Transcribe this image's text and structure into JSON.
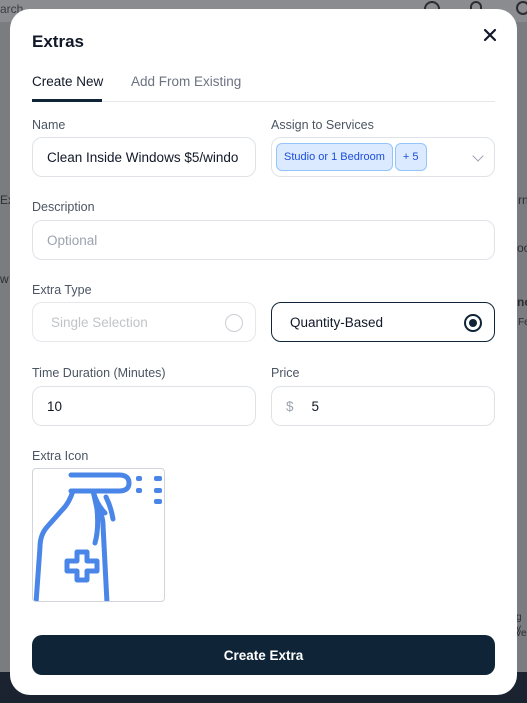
{
  "background": {
    "search_text": "arch",
    "fragments": [
      "Ex",
      "w",
      "rn",
      "oo",
      "no",
      "Fe",
      "g y",
      "ve"
    ]
  },
  "modal": {
    "title": "Extras",
    "close_icon": "close-icon",
    "tabs": [
      {
        "label": "Create New",
        "active": true
      },
      {
        "label": "Add From Existing",
        "active": false
      }
    ],
    "name": {
      "label": "Name",
      "value": "Clean Inside Windows $5/windo"
    },
    "assign": {
      "label": "Assign to Services",
      "chips": [
        "Studio or 1 Bedroom",
        "+ 5"
      ]
    },
    "description": {
      "label": "Description",
      "placeholder": "Optional"
    },
    "extra_type": {
      "label": "Extra Type",
      "options": [
        {
          "label": "Single Selection",
          "selected": false
        },
        {
          "label": "Quantity-Based",
          "selected": true
        }
      ]
    },
    "time_duration": {
      "label": "Time Duration (Minutes)",
      "value": "10"
    },
    "price": {
      "label": "Price",
      "currency": "$",
      "value": "5"
    },
    "extra_icon": {
      "label": "Extra Icon",
      "icon": "spray-bottle-icon"
    },
    "submit_label": "Create Extra"
  },
  "colors": {
    "primary": "#0f2537",
    "chip_bg": "#dbeafe",
    "chip_text": "#1d4ed8",
    "icon_blue": "#4a86e8"
  }
}
